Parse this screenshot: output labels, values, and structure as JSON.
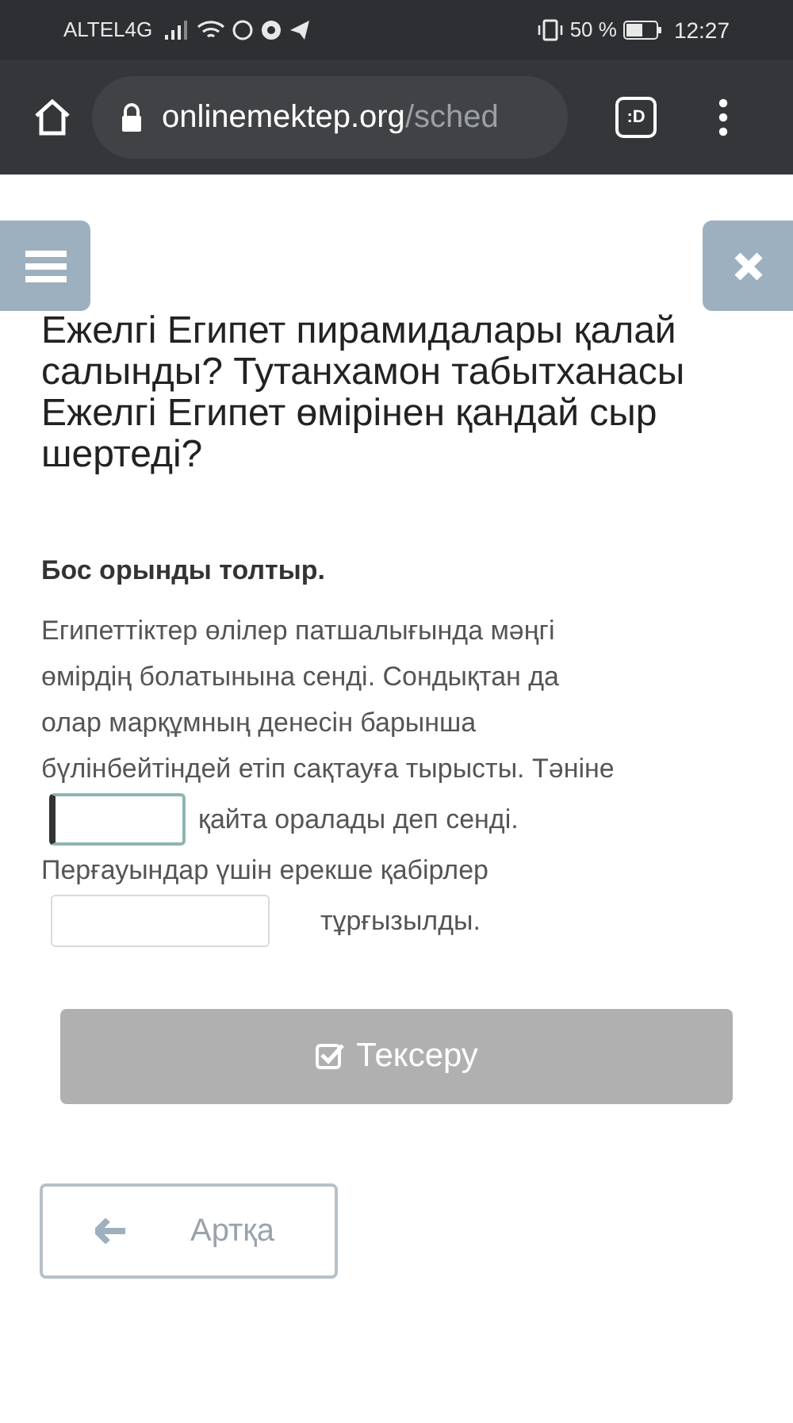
{
  "status_bar": {
    "carrier": "ALTEL4G",
    "battery_percent": "50 %",
    "time": "12:27"
  },
  "browser": {
    "url_host": "onlinemektep.org",
    "url_path": "/sched",
    "tab_icon_label": ":D"
  },
  "question_title": "Ежелгі Египет пирамидалары қалай салынды? Тутанхамон табытханасы Ежелгі Египет өмірінен қандай сыр шертеді?",
  "instruction": "Бос орынды толтыр.",
  "passage_lines": [
    [
      {
        "kind": "text",
        "text": "Египеттіктер өлілер патшалығында мәңгі"
      }
    ],
    [
      {
        "kind": "text",
        "text": "өмірдің болатынына сенді. Сондықтан да"
      }
    ],
    [
      {
        "kind": "text",
        "text": "олар марқұмның денесін барынша"
      }
    ],
    [
      {
        "kind": "text",
        "text": "бүлінбейтіндей етіп сақтауға тырысты. Тәніне"
      }
    ],
    [
      {
        "kind": "blank",
        "focused": true
      },
      {
        "kind": "text",
        "text": "қайта оралады деп сенді."
      }
    ],
    [
      {
        "kind": "text",
        "text": "Перғауындар үшін ерекше қабірлер"
      }
    ],
    [
      {
        "kind": "blank",
        "focused": false
      },
      {
        "kind": "text",
        "text": "тұрғызылды."
      }
    ]
  ],
  "check_button": {
    "label": "Тексеру",
    "disabled": true
  },
  "back_button": {
    "label": "Артқа"
  }
}
